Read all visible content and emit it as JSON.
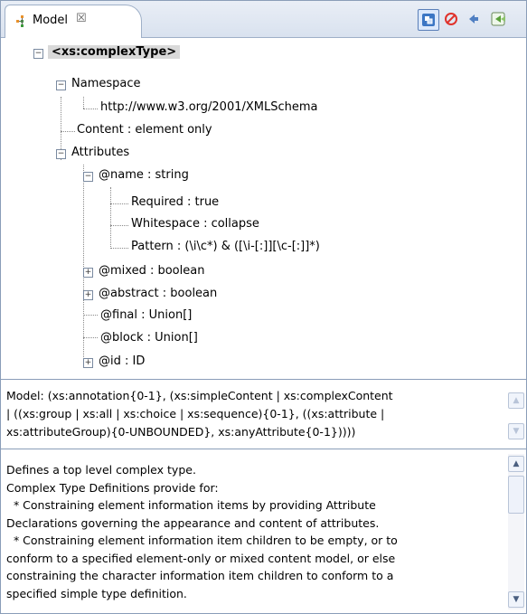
{
  "tab": {
    "label": "Model",
    "close": "☒"
  },
  "toolbar": {
    "sync_icon": "sync-icon",
    "stop_icon": "stop-icon",
    "back_icon": "back-arrow-icon",
    "goto_icon": "goto-definition-icon"
  },
  "tree": {
    "root": "<xs:complexType>",
    "namespace": "Namespace",
    "namespace_value": "http://www.w3.org/2001/XMLSchema",
    "content": "Content : element only",
    "attributes": "Attributes",
    "name_attr": "@name : string",
    "required": "Required : true",
    "whitespace": "Whitespace : collapse",
    "pattern": "Pattern : (\\i\\c*) & ([\\i-[:]][\\c-[:]]*)",
    "mixed": "@mixed : boolean",
    "abstract": "@abstract : boolean",
    "final": "@final : Union[]",
    "block": "@block : Union[]",
    "id": "@id : ID"
  },
  "model": {
    "line1": "Model: (xs:annotation{0-1}, (xs:simpleContent | xs:complexContent",
    "line2": "| ((xs:group | xs:all | xs:choice | xs:sequence){0-1}, ((xs:attribute |",
    "line3": "xs:attributeGroup){0-UNBOUNDED}, xs:anyAttribute{0-1}))))"
  },
  "doc": {
    "lines": [
      "Defines a top level complex type.",
      "Complex Type Definitions provide for:",
      "  * Constraining element information items by providing Attribute",
      "Declarations governing the appearance and content of attributes.",
      "  * Constraining element information item children to be empty, or to",
      "conform to a specified element-only or mixed content model, or else",
      "constraining the character information item children to conform to a",
      "specified simple type definition."
    ]
  },
  "colors": {
    "accent": "#5a7fb8",
    "stop": "#e0322b",
    "border": "#8a9db8"
  }
}
